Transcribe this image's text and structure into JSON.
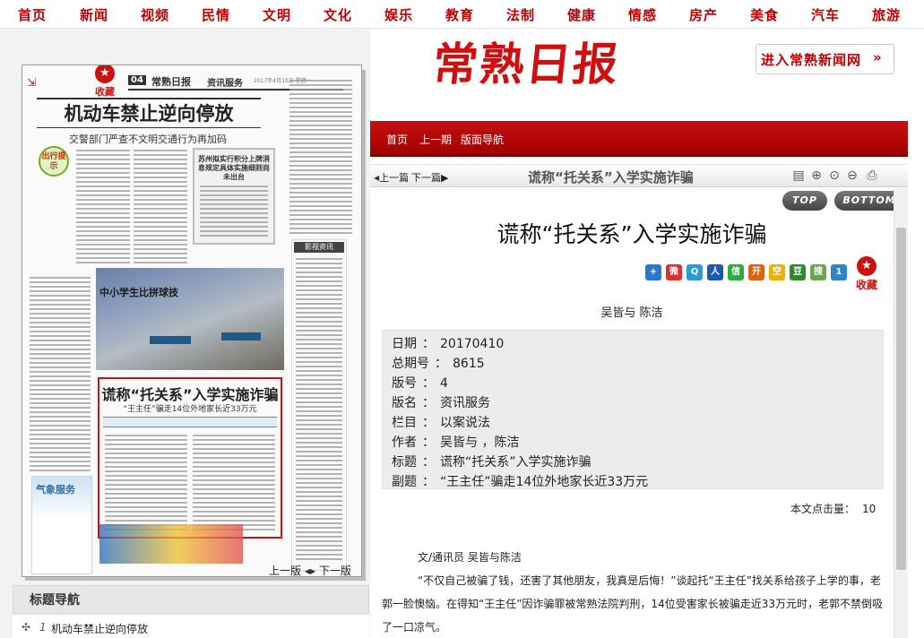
{
  "topnav": {
    "items": [
      "首页",
      "新闻",
      "视频",
      "民情",
      "文明",
      "文化",
      "娱乐",
      "教育",
      "法制",
      "健康",
      "情感",
      "房产",
      "美食",
      "汽车",
      "旅游"
    ]
  },
  "paper_preview": {
    "favorite_label": "收藏",
    "favorite_icon": "star-icon",
    "page_no": "04",
    "paper_name": "常熟日报",
    "section": "资讯服务",
    "date_line": "2017年4月10日 星期一",
    "headline_main": "机动车禁止逆向停放",
    "headline_sub": "交警部门严查不文明交通行为再加码",
    "tag_text": "出行提示",
    "inner_box_title": "苏州拟实行积分上牌消息规定具体实施细则尚未出台",
    "movie_header": "影视资讯",
    "photo_caption": "中小学生比拼球技",
    "headline_second": "谎称“托关系”入学实施诈骗",
    "headline_second_sub": "“王主任”骗走14位外地家长近33万元",
    "ad_title": "气象服务"
  },
  "page_nav": {
    "prev": "上一版",
    "next": "下一版"
  },
  "title_nav": {
    "heading": "标题导航",
    "items": [
      {
        "num": "1",
        "title": "机动车禁止逆向停放"
      }
    ]
  },
  "masthead": {
    "logo": "常熟日报",
    "enter_button": "进入常熟新闻网"
  },
  "red_nav": {
    "items": [
      "首页",
      "上一期",
      "版面导航"
    ]
  },
  "toolbar": {
    "prev_article": "上一篇",
    "next_article": "下一篇",
    "title": "谎称“托关系”入学实施诈骗",
    "icons": [
      "printer-icon",
      "zoom-in-icon",
      "zoom-reset-icon",
      "zoom-out-icon",
      "print-icon"
    ]
  },
  "top_button": "TOP",
  "bottom_button": "BOTTOM",
  "article": {
    "title": "谎称“托关系”入学实施诈骗",
    "author": "吴皆与 陈洁",
    "favorite_label": "收藏",
    "share_icons": [
      {
        "name": "share-plus-icon",
        "color": "#2a78c8",
        "glyph": "+"
      },
      {
        "name": "weibo-icon",
        "color": "#e0302b",
        "glyph": "微"
      },
      {
        "name": "tencent-weibo-icon",
        "color": "#2b9ad6",
        "glyph": "Q"
      },
      {
        "name": "renren-icon",
        "color": "#1d5aa8",
        "glyph": "人"
      },
      {
        "name": "wechat-icon",
        "color": "#2aae3a",
        "glyph": "信"
      },
      {
        "name": "kaixin-icon",
        "color": "#e06010",
        "glyph": "开"
      },
      {
        "name": "qzone-icon",
        "color": "#f0b000",
        "glyph": "空"
      },
      {
        "name": "douban-icon",
        "color": "#2e8a2e",
        "glyph": "豆"
      },
      {
        "name": "sohu-icon",
        "color": "#6aa84f",
        "glyph": "搜"
      },
      {
        "name": "share-one-icon",
        "color": "#2f83c6",
        "glyph": "1"
      }
    ],
    "meta": [
      {
        "key": "日期",
        "value": "20170410"
      },
      {
        "key": "总期号",
        "value": "8615"
      },
      {
        "key": "版号",
        "value": "4"
      },
      {
        "key": "版名",
        "value": "资讯服务"
      },
      {
        "key": "栏目",
        "value": "以案说法"
      },
      {
        "key": "作者",
        "value": "吴皆与 ，陈洁"
      },
      {
        "key": "标题",
        "value": "谎称“托关系”入学实施诈骗"
      },
      {
        "key": "副题",
        "value": "“王主任”骗走14位外地家长近33万元"
      }
    ],
    "hit_label": "本文点击量：",
    "hit_count": "10",
    "byline": "文/通讯员 吴皆与陈洁",
    "paragraph_1": "“不仅自己被骗了钱，还害了其他朋友，我真是后悔！”谈起托“王主任”找关系给孩子上学的事，老郭一脸懊恼。在得知“王主任”因诈骗罪被常熟法院判刑，14位受害家长被骗走近33万元时，老郭不禁倒吸了一口凉气。"
  },
  "colors": {
    "brand_red": "#c00000",
    "nav_red": "#a40000"
  }
}
